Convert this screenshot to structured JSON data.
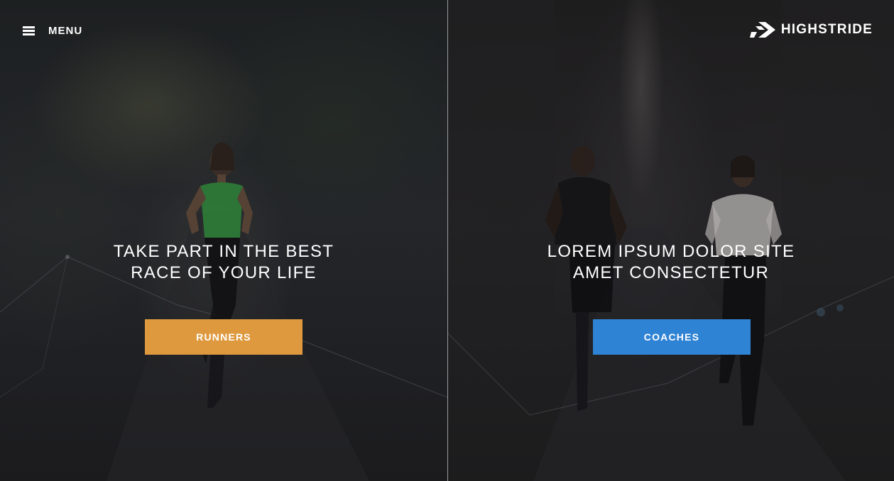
{
  "header": {
    "menu_label": "MENU",
    "menu_icon": "hamburger-icon",
    "brand_name": "HIGHSTRIDE",
    "brand_icon": "highstride-chevron-logo"
  },
  "panels": [
    {
      "headline_line1": "TAKE PART IN THE BEST",
      "headline_line2": "RACE OF YOUR LIFE",
      "button_label": "RUNNERS",
      "button_color": "#de993f"
    },
    {
      "headline_line1": "LOREM IPSUM DOLOR SITE",
      "headline_line2": "AMET CONSECTETUR",
      "button_label": "COACHES",
      "button_color": "#2f83d5"
    }
  ],
  "colors": {
    "background": "#1c1c1d",
    "divider": "#9a9a9a",
    "text": "#ffffff"
  }
}
